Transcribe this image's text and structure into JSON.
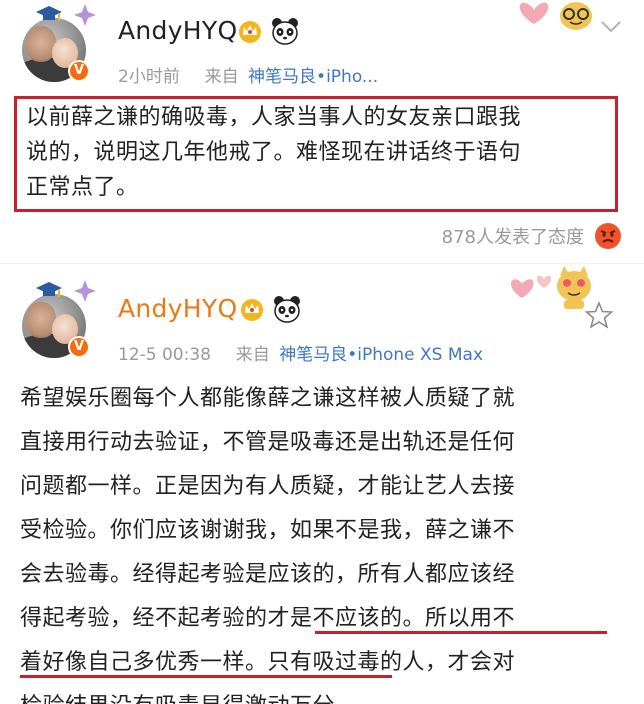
{
  "post1": {
    "username": "AndyHYQ",
    "time": "2小时前",
    "source_prefix": "来自",
    "source": "神笔马良•iPho...",
    "vip_badge": "V",
    "text_lines": [
      "以前薛之谦的确吸毒，人家当事人的女友亲口跟我",
      "说的，说明这几年他戒了。难怪现在讲话终于语句",
      "正常点了。"
    ],
    "reaction_text": "878人发表了态度",
    "reaction_icon": "angry-face-icon",
    "highlight_color": "#c9202f"
  },
  "post2": {
    "username": "AndyHYQ",
    "time": "12-5 00:38",
    "source_prefix": "来自",
    "source": "神笔马良•iPhone XS Max",
    "vip_badge": "V",
    "text_lines": [
      "希望娱乐圈每个人都能像薛之谦这样被人质疑了就",
      "直接用行动去验证，不管是吸毒还是出轨还是任何",
      "问题都一样。正是因为有人质疑，才能让艺人去接",
      "受检验。你们应该谢谢我，如果不是我，薛之谦不",
      "会去验毒。经得起考验是应该的，所有人都应该经",
      "得起考验，经不起考验的才是不应该的。所以用不",
      "着好像自己多优秀一样。只有吸过毒的人，才会对",
      "检验结果没有吸毒显得激动万分。"
    ],
    "username_color": "#ec7a12",
    "underline_color": "#c9202f"
  },
  "colors": {
    "link": "#3f77c8",
    "meta_gray": "#9a9a9a",
    "vip_orange": "#f56b0d"
  }
}
